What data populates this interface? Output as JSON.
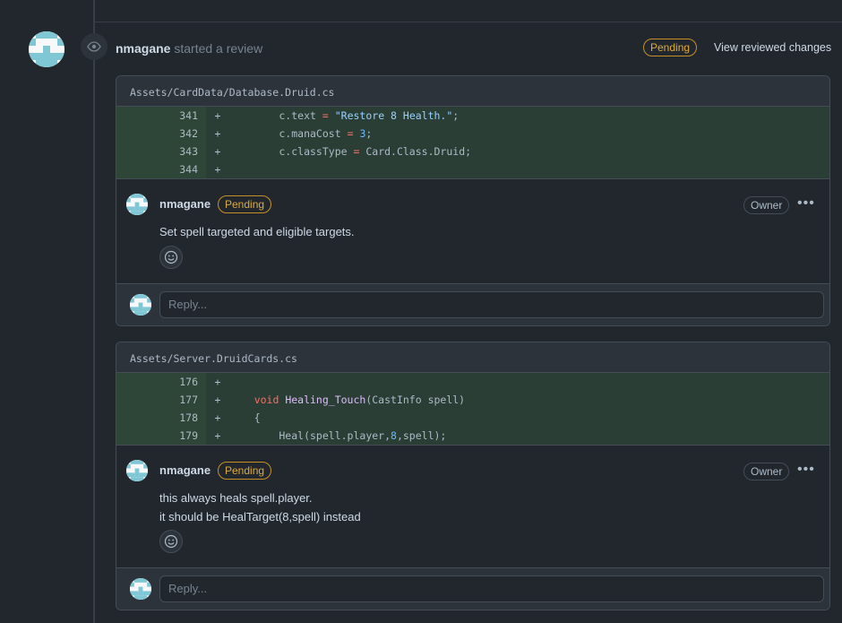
{
  "review": {
    "author": "nmagane",
    "action": "started a review",
    "status": "Pending",
    "view_changes_label": "View reviewed changes"
  },
  "threads": [
    {
      "file_path": "Assets/CardData/Database.Druid.cs",
      "diff": [
        {
          "num": "341",
          "marker": "+"
        },
        {
          "num": "342",
          "marker": "+"
        },
        {
          "num": "343",
          "marker": "+"
        },
        {
          "num": "344",
          "marker": "+"
        }
      ],
      "comment": {
        "author": "nmagane",
        "status": "Pending",
        "role": "Owner",
        "body_lines": [
          "Set spell targeted and eligible targets."
        ]
      },
      "reply_placeholder": "Reply..."
    },
    {
      "file_path": "Assets/Server.DruidCards.cs",
      "diff": [
        {
          "num": "176",
          "marker": "+"
        },
        {
          "num": "177",
          "marker": "+"
        },
        {
          "num": "178",
          "marker": "+"
        },
        {
          "num": "179",
          "marker": "+"
        }
      ],
      "comment": {
        "author": "nmagane",
        "status": "Pending",
        "role": "Owner",
        "body_lines": [
          "this always heals spell.player.",
          "it should be HealTarget(8,spell) instead"
        ]
      },
      "reply_placeholder": "Reply..."
    }
  ],
  "code_tokens": {
    "t0": {
      "l341": [
        "        c.text ",
        "=",
        " ",
        "\"Restore 8 Health.\"",
        ";"
      ],
      "l342": [
        "        c.manaCost ",
        "=",
        " ",
        "3",
        ";"
      ],
      "l343": [
        "        c.classType ",
        "=",
        " Card.Class.Druid;"
      ]
    },
    "t1": {
      "l177": [
        "    void ",
        "Healing_Touch",
        "(CastInfo spell)"
      ],
      "l178": [
        "    {"
      ],
      "l179": [
        "        Heal(spell.player,",
        "8",
        ",spell);"
      ]
    }
  },
  "colors": {
    "accent_pending": "#c69026",
    "diff_added_bg": "#2b3e35",
    "page_bg": "#22272e"
  },
  "icons": [
    "eye-icon",
    "smiley-icon",
    "kebab-horizontal-icon",
    "identicon-avatar"
  ]
}
